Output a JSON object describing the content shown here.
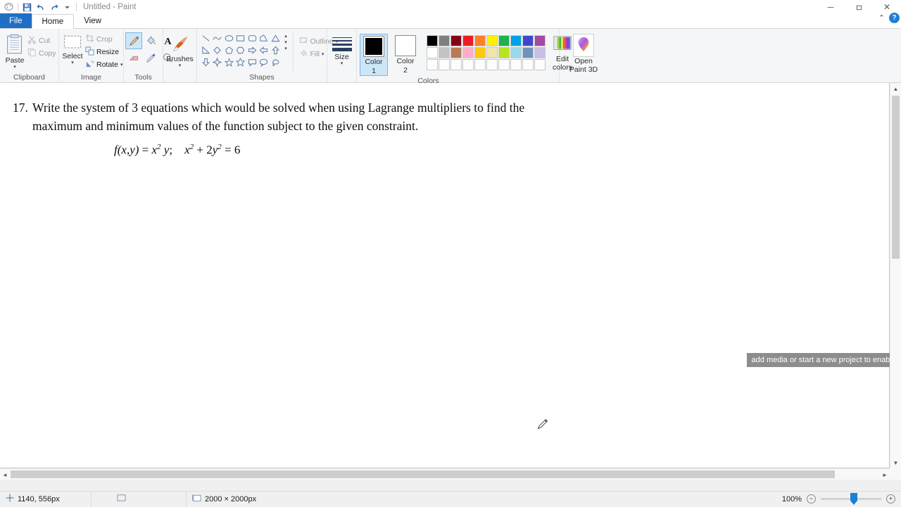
{
  "window": {
    "title": "Untitled - Paint",
    "quick_access": [
      {
        "name": "paint-app-icon",
        "glyph": "palette"
      },
      {
        "name": "save-icon",
        "glyph": "floppy"
      },
      {
        "name": "undo-icon",
        "glyph": "undo"
      },
      {
        "name": "redo-icon",
        "glyph": "redo"
      },
      {
        "name": "customize-qat-caret",
        "glyph": "caret"
      }
    ],
    "controls": {
      "minimize": "─",
      "restore": "❐",
      "close": "✕",
      "collapse_ribbon": "⌃",
      "help": "?"
    }
  },
  "tabs": [
    {
      "id": "file",
      "label": "File",
      "active": false
    },
    {
      "id": "home",
      "label": "Home",
      "active": true
    },
    {
      "id": "view",
      "label": "View",
      "active": false
    }
  ],
  "ribbon": {
    "groups": [
      {
        "id": "clipboard",
        "label": "Clipboard"
      },
      {
        "id": "image",
        "label": "Image"
      },
      {
        "id": "tools",
        "label": "Tools"
      },
      {
        "id": "shapes",
        "label": "Shapes"
      },
      {
        "id": "colors",
        "label": "Colors"
      }
    ],
    "clipboard": {
      "paste_label": "Paste",
      "cut_label": "Cut",
      "copy_label": "Copy"
    },
    "image": {
      "select_label": "Select",
      "crop_label": "Crop",
      "resize_label": "Resize",
      "rotate_label": "Rotate"
    },
    "tools": {
      "items": [
        {
          "name": "pencil-tool",
          "selected": true
        },
        {
          "name": "fill-bucket-tool",
          "selected": false
        },
        {
          "name": "text-tool",
          "selected": false
        },
        {
          "name": "eraser-tool",
          "selected": false
        },
        {
          "name": "color-picker-tool",
          "selected": false
        },
        {
          "name": "magnifier-tool",
          "selected": false
        }
      ]
    },
    "brushes": {
      "label": "Brushes"
    },
    "shapes": {
      "row1": [
        "line",
        "curve",
        "oval",
        "rectangle",
        "rounded-rectangle",
        "polygon",
        "triangle"
      ],
      "row2": [
        "right-triangle",
        "diamond",
        "pentagon",
        "hexagon",
        "right-arrow",
        "left-arrow",
        "up-arrow"
      ],
      "row3": [
        "down-arrow",
        "four-point-star",
        "five-point-star",
        "six-point-star",
        "rounded-callout",
        "oval-callout",
        "cloud-callout"
      ],
      "outline_label": "Outline",
      "fill_label": "Fill"
    },
    "size": {
      "label": "Size",
      "thicknesses": [
        1,
        2,
        3,
        5
      ]
    },
    "colors": {
      "color1_label": "Color",
      "color1_index": "1",
      "color1_value": "#000000",
      "color1_selected": true,
      "color2_label": "Color",
      "color2_index": "2",
      "color2_value": "#ffffff",
      "edit_colors_label": "Edit\ncolors",
      "edit_colors_line1": "Edit",
      "edit_colors_line2": "colors",
      "palette_row1": [
        "#000000",
        "#7f7f7f",
        "#880015",
        "#ed1c24",
        "#ff7f27",
        "#fff200",
        "#22b14c",
        "#00a2e8",
        "#3f48cc",
        "#a349a4"
      ],
      "palette_row2": [
        "#ffffff",
        "#c3c3c3",
        "#b97a57",
        "#ffaec9",
        "#ffc90e",
        "#efe4b0",
        "#b5e61d",
        "#99d9ea",
        "#7092be",
        "#c8bfe7"
      ],
      "palette_row3": [
        "#ffffff",
        "#ffffff",
        "#ffffff",
        "#ffffff",
        "#ffffff",
        "#ffffff",
        "#ffffff",
        "#ffffff",
        "#ffffff",
        "#ffffff"
      ]
    },
    "paint3d": {
      "line1": "Open",
      "line2": "Paint 3D"
    }
  },
  "canvas": {
    "question_number": "17.",
    "line1": "Write the system of 3 equations which would be solved when using Lagrange multipliers to find the",
    "line2": "maximum and minimum values of the function subject to the given constraint.",
    "equation": {
      "fn_name": "f",
      "fn_args": "(x,y)",
      "eq1_rhs_base": "x",
      "eq1_rhs_exp": "2",
      "eq1_rhs_var": "y",
      "semicolon": ";",
      "constraint_a_base": "x",
      "constraint_a_exp": "2",
      "plus": "+",
      "constraint_b_coef": "2",
      "constraint_b_base": "y",
      "constraint_b_exp": "2",
      "equals": "=",
      "constraint_value": "6",
      "full_text": "f(x,y) = x² y;   x² + 2y² = 6"
    },
    "cursor": "pencil-cursor"
  },
  "toast": {
    "message": "add media or start a new project to enable"
  },
  "statusbar": {
    "cursor_position": "1140, 556px",
    "selection_icon": "selection-size-icon",
    "image_size": "2000 × 2000px",
    "zoom_level": "100%",
    "zoom_out": "−",
    "zoom_in": "+"
  }
}
